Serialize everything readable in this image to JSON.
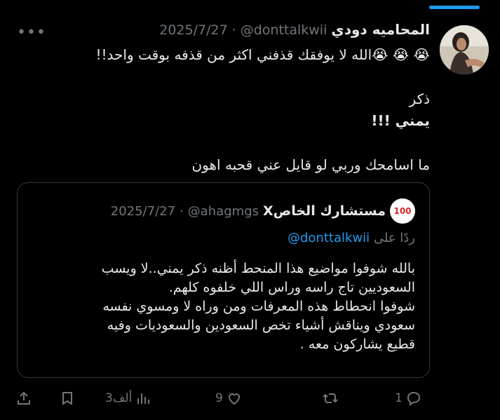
{
  "tweet": {
    "display_name": "المحاميه دودي",
    "handle": "@donttalkwii",
    "date": "2025/7/27",
    "separator": "·",
    "more_label": "•••",
    "lines": [
      "😭 😭 😭الله لا يوفقك قذفني اكثر من قذفه بوقت واحد!!",
      "ذكر",
      "يمني !!!",
      "ما اسامحك وربي لو قايل عني قحبه اهون"
    ]
  },
  "quote": {
    "avatar_text": "100",
    "display_name": "مستشارك الخاصX",
    "handle": "@ahagmgs",
    "date": "2025/7/27",
    "separator": "·",
    "reply_label": "ردًا على",
    "reply_to": "@donttalkwii",
    "body": [
      "بالله شوفوا مواضيع هذا المنحط أظنه ذكر يمني..لا ويسب",
      "السعوديين تاج راسه وراس اللي خلفوه كلهم.",
      "شوفوا انحطاط هذه المعرفات ومن وراه لا ومسوي نفسه",
      "سعودي ويناقش أشياء تخص السعودين والسعوديات وفيه",
      "قطيع يشاركون معه ."
    ]
  },
  "actions": {
    "replies": "1",
    "reposts": "",
    "likes": "9",
    "views": "3ألف"
  },
  "colors": {
    "accent": "#1d9bf0",
    "muted": "#71767b",
    "text": "#e7e9ea",
    "background": "#000000"
  },
  "icons": [
    "reply-icon",
    "repost-icon",
    "like-icon",
    "views-icon",
    "bookmark-icon",
    "share-icon"
  ]
}
